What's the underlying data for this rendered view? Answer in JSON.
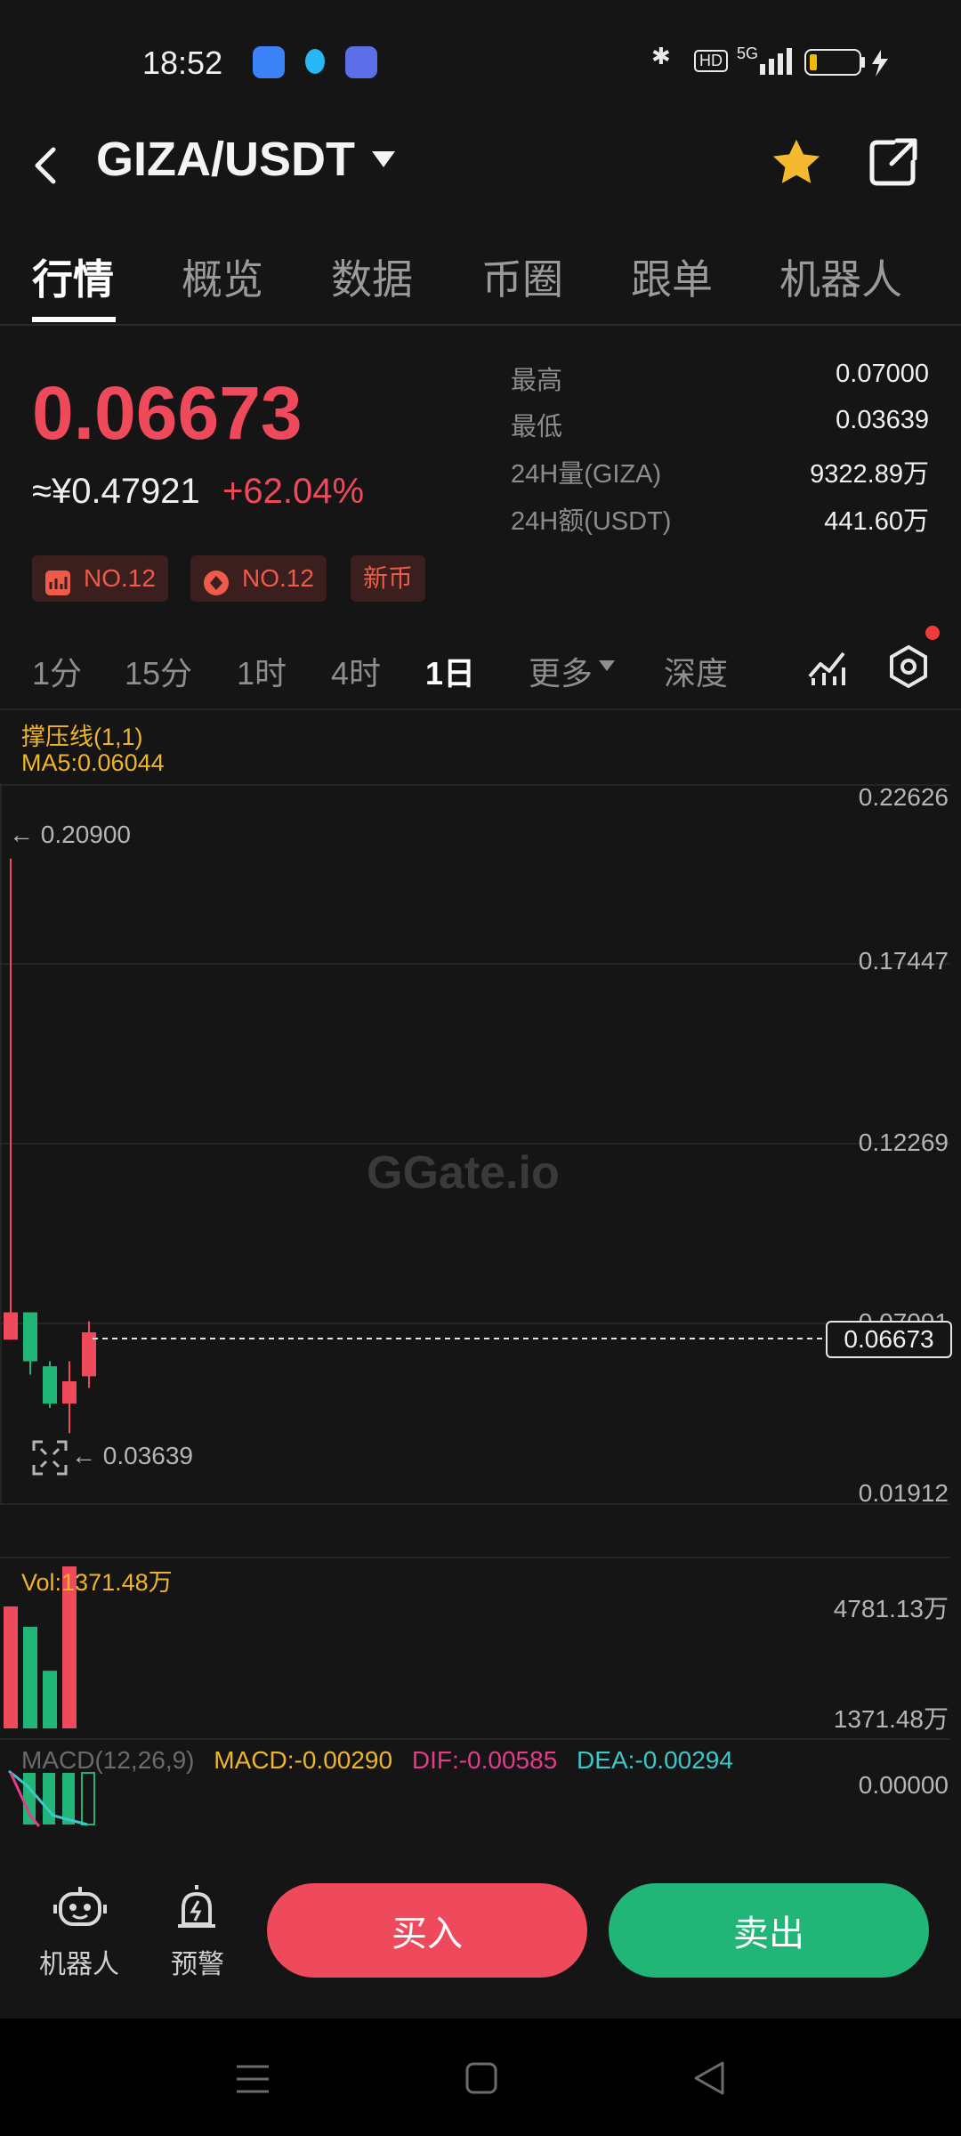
{
  "status_bar": {
    "time": "18:52",
    "network": "5G",
    "hd": "HD"
  },
  "header": {
    "pair": "GIZA/USDT"
  },
  "tabs": [
    {
      "label": "行情",
      "active": true
    },
    {
      "label": "概览"
    },
    {
      "label": "数据"
    },
    {
      "label": "币圈"
    },
    {
      "label": "跟单"
    },
    {
      "label": "机器人"
    }
  ],
  "ticker": {
    "price": "0.06673",
    "cny_price": "≈¥0.47921",
    "change": "+62.04%",
    "stats": [
      {
        "label": "最高",
        "value": "0.07000"
      },
      {
        "label": "最低",
        "value": "0.03639"
      },
      {
        "label": "24H量(GIZA)",
        "value": "9322.89万"
      },
      {
        "label": "24H额(USDT)",
        "value": "441.60万"
      }
    ],
    "badges": [
      {
        "icon": "chart-badge-icon",
        "label": "NO.12"
      },
      {
        "icon": "fire-badge-icon",
        "label": "NO.12"
      },
      {
        "icon": "",
        "label": "新币"
      }
    ]
  },
  "intervals": [
    {
      "label": "1分"
    },
    {
      "label": "15分"
    },
    {
      "label": "1时"
    },
    {
      "label": "4时"
    },
    {
      "label": "1日",
      "active": true
    },
    {
      "label": "更多"
    },
    {
      "label": "深度"
    }
  ],
  "chart": {
    "indicator_line1": "撑压线(1,1)",
    "indicator_line2": "MA5:0.06044",
    "watermark": "Gate.io",
    "high_marker": "0.20900",
    "low_marker": "0.03639",
    "current_price_label": "0.06673",
    "y_axis": [
      "0.22626",
      "0.17447",
      "0.12269",
      "0.07091",
      "0.01912"
    ],
    "volume": {
      "label": "Vol:1371.48万",
      "axis_top": "4781.13万",
      "axis_bottom": "1371.48万"
    },
    "macd": {
      "label": "MACD(12,26,9)",
      "macd": "MACD:-0.00290",
      "dif": "DIF:-0.00585",
      "dea": "DEA:-0.00294",
      "axis": "0.00000"
    }
  },
  "chart_data": {
    "type": "candlestick",
    "y_axis_ticks": [
      0.22626,
      0.17447,
      0.12269,
      0.07091,
      0.01912
    ],
    "candles": [
      {
        "open": 0.0645,
        "close": 0.0727,
        "high": 0.209,
        "low": 0.0645,
        "dir": "up"
      },
      {
        "open": 0.0727,
        "close": 0.058,
        "high": 0.0727,
        "low": 0.054,
        "dir": "down"
      },
      {
        "open": 0.0565,
        "close": 0.0453,
        "high": 0.058,
        "low": 0.044,
        "dir": "down"
      },
      {
        "open": 0.0453,
        "close": 0.052,
        "high": 0.058,
        "low": 0.03639,
        "dir": "up"
      },
      {
        "open": 0.0535,
        "close": 0.0667,
        "high": 0.07,
        "low": 0.05,
        "dir": "up"
      }
    ],
    "volumes_wan": [
      3600,
      3000,
      1700,
      4781.13
    ],
    "volume_colors": [
      "up",
      "down",
      "down",
      "up"
    ],
    "colors": {
      "up": "#ef4a5b",
      "down": "#22b578",
      "ma": "#f0b429"
    }
  },
  "bottom_bar": {
    "robot_label": "机器人",
    "alert_label": "预警",
    "buy_label": "买入",
    "sell_label": "卖出"
  }
}
